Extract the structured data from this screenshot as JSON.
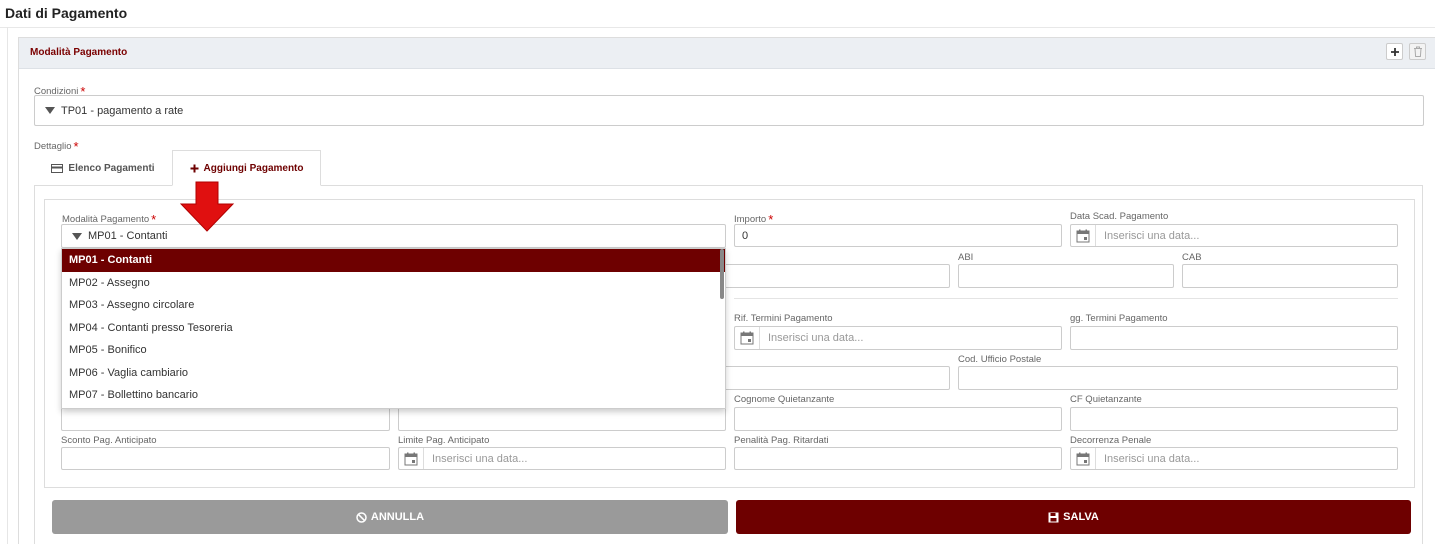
{
  "page": {
    "title": "Dati di Pagamento"
  },
  "panel": {
    "title": "Modalità Pagamento"
  },
  "condizioni": {
    "label": "Condizioni",
    "value": "TP01 - pagamento a rate"
  },
  "dettaglio": {
    "label": "Dettaglio"
  },
  "tabs": [
    {
      "label": "Elenco Pagamenti",
      "icon": "card-icon",
      "active": false
    },
    {
      "label": "Aggiungi Pagamento",
      "icon": "plus-icon",
      "active": true
    }
  ],
  "form": {
    "modalita": {
      "label": "Modalità Pagamento",
      "value": "MP01 - Contanti"
    },
    "importo": {
      "label": "Importo",
      "value": "0"
    },
    "data_scad": {
      "label": "Data Scad. Pagamento",
      "placeholder": "Inserisci una data..."
    },
    "abi": {
      "label": "ABI"
    },
    "cab": {
      "label": "CAB"
    },
    "rif_termini": {
      "label": "Rif. Termini Pagamento",
      "placeholder": "Inserisci una data..."
    },
    "gg_termini": {
      "label": "gg. Termini Pagamento"
    },
    "cod_ufficio": {
      "label": "Cod. Ufficio Postale"
    },
    "cognome_quiet": {
      "label": "Cognome Quietanzante"
    },
    "cf_quiet": {
      "label": "CF Quietanzante"
    },
    "sconto": {
      "label": "Sconto Pag. Anticipato"
    },
    "limite": {
      "label": "Limite Pag. Anticipato",
      "placeholder": "Inserisci una data..."
    },
    "penalita": {
      "label": "Penalità Pag. Ritardati"
    },
    "decorrenza": {
      "label": "Decorrenza Penale",
      "placeholder": "Inserisci una data..."
    }
  },
  "dropdown": {
    "options": [
      "MP01 - Contanti",
      "MP02 - Assegno",
      "MP03 - Assegno circolare",
      "MP04 - Contanti presso Tesoreria",
      "MP05 - Bonifico",
      "MP06 - Vaglia cambiario",
      "MP07 - Bollettino bancario"
    ],
    "selected_index": 0
  },
  "buttons": {
    "annulla": "ANNULLA",
    "salva": "SALVA"
  },
  "colors": {
    "accent": "#6e0000",
    "required": "#cc0000",
    "arrow": "#e01010",
    "cancel": "#9a9a9a"
  }
}
